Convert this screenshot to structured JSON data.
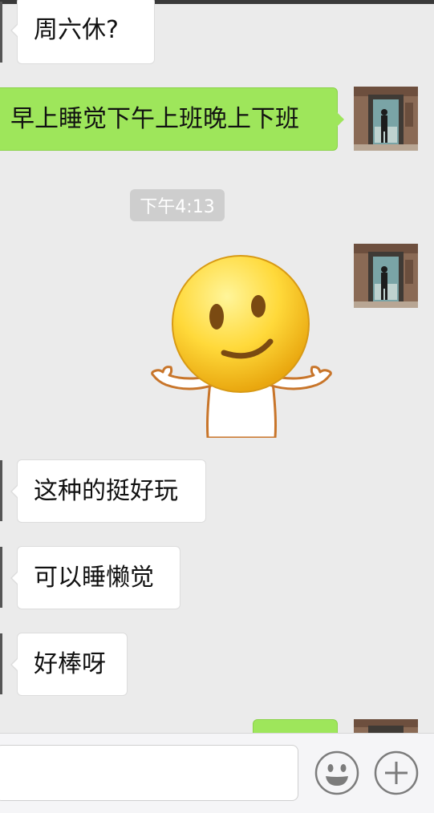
{
  "messages": [
    {
      "side": "incoming",
      "text": "周六休?"
    },
    {
      "side": "outgoing",
      "text": "早上睡觉下午上班晚上下班"
    },
    {
      "side": "outgoing",
      "sticker": "smiley-shrug-sticker"
    },
    {
      "side": "incoming",
      "text": "这种的挺好玩"
    },
    {
      "side": "incoming",
      "text": "可以睡懒觉"
    },
    {
      "side": "incoming",
      "text": "好棒呀"
    },
    {
      "side": "outgoing",
      "text": ""
    }
  ],
  "timestamp": "下午4:13",
  "input": {
    "value": "",
    "placeholder": ""
  },
  "icons": {
    "emoji": "smiley-face-icon",
    "plus": "plus-icon"
  },
  "colors": {
    "background": "#ebebeb",
    "incoming_bubble": "#ffffff",
    "outgoing_bubble": "#9ee65b",
    "timestamp_bg": "#cecece"
  }
}
